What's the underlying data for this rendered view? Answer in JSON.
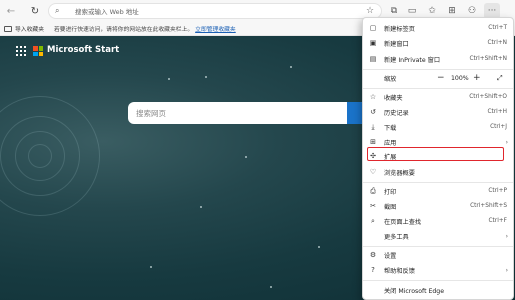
{
  "toolbar": {
    "address_placeholder": "搜索或输入 Web 地址"
  },
  "favorites_bar": {
    "import_label": "导入收藏夹",
    "hint_text": "若要进行快速访问，请将你的网站放在此收藏夹栏上。",
    "manage_link": "立即管理收藏夹"
  },
  "page": {
    "brand": "Microsoft Start",
    "search_placeholder": "搜索网页",
    "logo_colors": [
      "#f25022",
      "#7fba00",
      "#00a4ef",
      "#ffb900"
    ]
  },
  "menu": {
    "items": [
      {
        "label": "新建标签页",
        "shortcut": "Ctrl+T",
        "icon": "new-tab-icon"
      },
      {
        "label": "新建窗口",
        "shortcut": "Ctrl+N",
        "icon": "new-window-icon"
      },
      {
        "label": "新建 InPrivate 窗口",
        "shortcut": "Ctrl+Shift+N",
        "icon": "inprivate-icon"
      },
      {
        "label": "缩放",
        "zoom_value": "100%"
      },
      {
        "label": "收藏夹",
        "shortcut": "Ctrl+Shift+O",
        "icon": "favorites-icon"
      },
      {
        "label": "历史记录",
        "shortcut": "Ctrl+H",
        "icon": "history-icon"
      },
      {
        "label": "下载",
        "shortcut": "Ctrl+J",
        "icon": "download-icon"
      },
      {
        "label": "应用",
        "icon": "apps-icon"
      },
      {
        "label": "扩展",
        "icon": "extensions-icon"
      },
      {
        "label": "浏览器概要",
        "icon": "browser-essentials-icon"
      },
      {
        "label": "打印",
        "shortcut": "Ctrl+P",
        "icon": "print-icon"
      },
      {
        "label": "截图",
        "shortcut": "Ctrl+Shift+S",
        "icon": "screenshot-icon"
      },
      {
        "label": "在页面上查找",
        "shortcut": "Ctrl+F",
        "icon": "find-icon"
      },
      {
        "label": "更多工具"
      },
      {
        "label": "设置",
        "icon": "settings-icon"
      },
      {
        "label": "帮助和反馈",
        "icon": "help-icon"
      },
      {
        "label": "关闭 Microsoft Edge"
      }
    ],
    "highlight_color": "#e0262d"
  }
}
